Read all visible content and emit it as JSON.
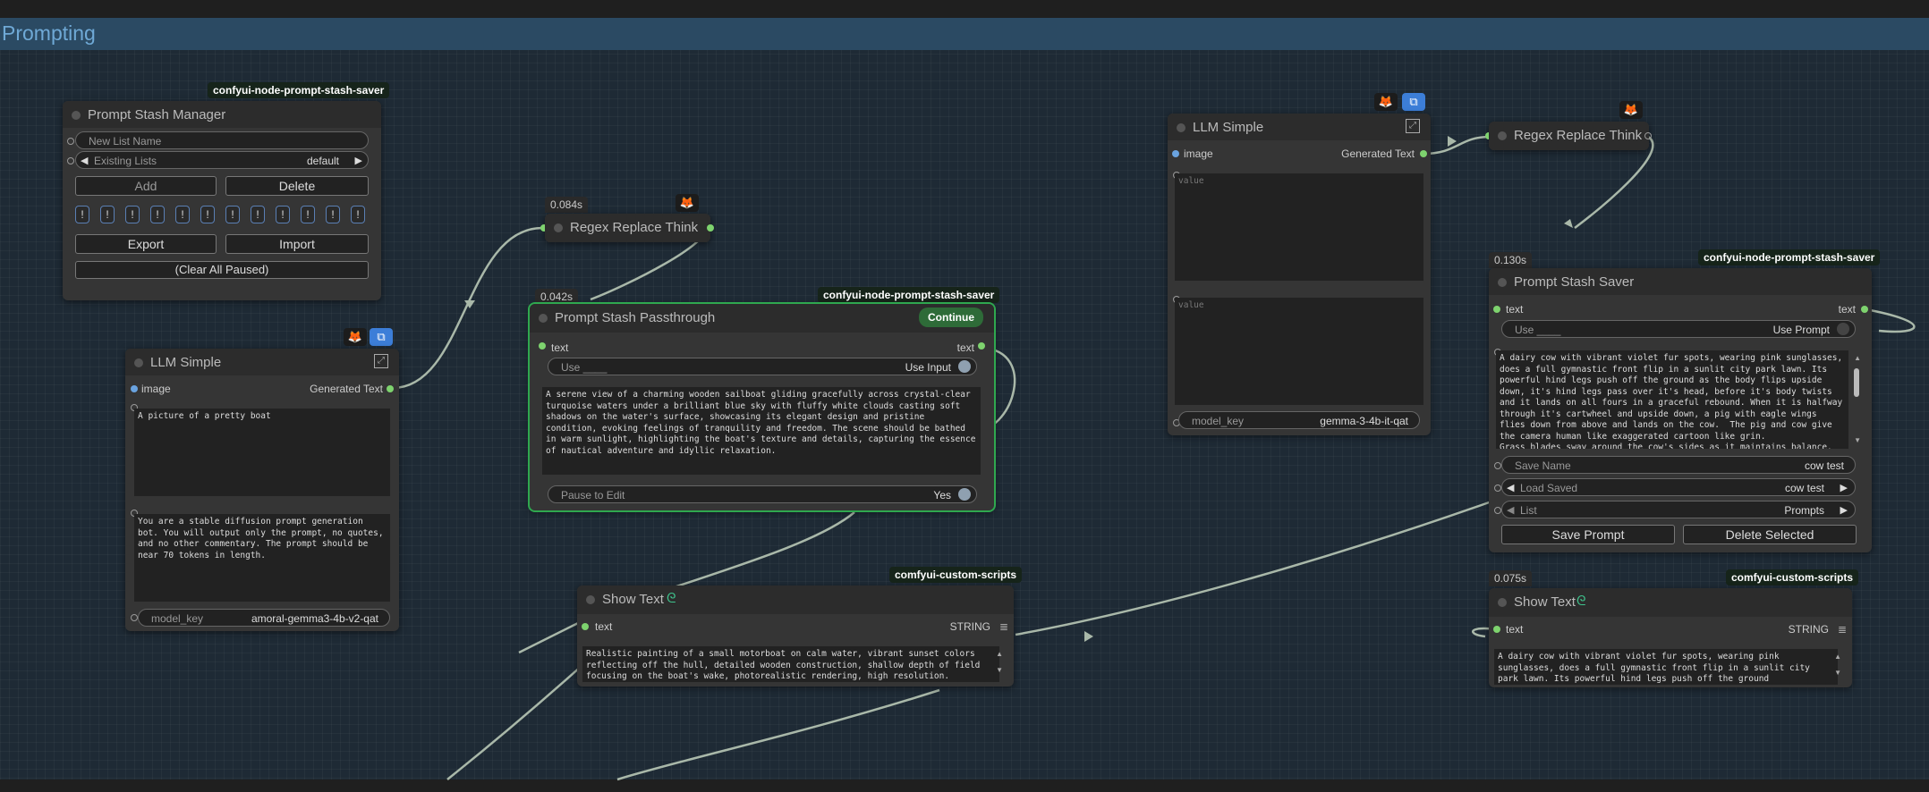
{
  "group": {
    "title": "Prompting"
  },
  "stash_manager": {
    "badge": "confyui-node-prompt-stash-saver",
    "title": "Prompt Stash Manager",
    "new_list_placeholder": "New List Name",
    "existing_lists_label": "Existing Lists",
    "existing_lists_value": "default",
    "add_label": "Add",
    "delete_label": "Delete",
    "pause_buttons": [
      "!",
      "!",
      "!",
      "!",
      "!",
      "!",
      "!",
      "!",
      "!",
      "!",
      "!",
      "!"
    ],
    "export_label": "Export",
    "import_label": "Import",
    "clear_label": "(Clear All Paused)"
  },
  "llm_left": {
    "title": "LLM Simple",
    "input_image": "image",
    "output_label": "Generated Text",
    "prompt_text": "A picture of a pretty boat",
    "system_text": "You are a stable diffusion prompt generation bot. You will output only the prompt, no quotes, and no other commentary. The prompt should be near 70 tokens in length.",
    "model_key_label": "model_key",
    "model_key_value": "amoral-gemma3-4b-v2-qat"
  },
  "regex_mid": {
    "timer": "0.084s",
    "title": "Regex Replace Think"
  },
  "passthrough": {
    "timer": "0.042s",
    "badge": "confyui-node-prompt-stash-saver",
    "title": "Prompt Stash Passthrough",
    "continue_label": "Continue",
    "input_text": "text",
    "output_text": "text",
    "use_label": "Use ____",
    "use_value": "Use Input",
    "body_text": "A serene view of a charming wooden sailboat gliding gracefully across crystal-clear turquoise waters under a brilliant blue sky with fluffy white clouds casting soft shadows on the water's surface, showcasing its elegant design and pristine condition, evoking feelings of tranquility and freedom. The scene should be bathed in warm sunlight, highlighting the boat's texture and details, capturing the essence of nautical adventure and idyllic relaxation.",
    "pause_label": "Pause to Edit",
    "pause_value": "Yes"
  },
  "show_text_mid": {
    "badge": "comfyui-custom-scripts",
    "title": "Show Text",
    "input_text": "text",
    "output_type": "STRING",
    "body_text": "Realistic painting of a small motorboat on calm water, vibrant sunset colors reflecting off the hull, detailed wooden construction, shallow depth of field focusing on the boat's wake, photorealistic rendering, high resolution."
  },
  "llm_right": {
    "title": "LLM Simple",
    "input_image": "image",
    "output_label": "Generated Text",
    "value_placeholder_1": "value",
    "value_placeholder_2": "value",
    "model_key_label": "model_key",
    "model_key_value": "gemma-3-4b-it-qat"
  },
  "regex_right": {
    "title": "Regex Replace Think"
  },
  "stash_saver": {
    "timer": "0.130s",
    "badge": "confyui-node-prompt-stash-saver",
    "title": "Prompt Stash Saver",
    "input_text": "text",
    "output_text": "text",
    "use_label": "Use ____",
    "use_value": "Use Prompt",
    "body_text": "A dairy cow with vibrant violet fur spots, wearing pink sunglasses, does a full gymnastic front flip in a sunlit city park lawn. Its powerful hind legs push off the ground as the body flips upside down, it's hind legs pass over it's head, before it's body twists and it lands on all fours in a graceful rebound. When it is halfway through it's cartwheel and upside down, a pig with eagle wings flies down from above and lands on the cow.  The pig and cow give the camera human like exaggerated cartoon like grin.\nGrass blades sway around the cow's sides as it maintains balance.",
    "save_name_label": "Save Name",
    "save_name_value": "cow test",
    "load_saved_label": "Load Saved",
    "load_saved_value": "cow test",
    "list_label": "List",
    "list_value": "Prompts",
    "save_prompt_label": "Save Prompt",
    "delete_selected_label": "Delete Selected"
  },
  "show_text_right": {
    "timer": "0.075s",
    "badge": "comfyui-custom-scripts",
    "title": "Show Text",
    "input_text": "text",
    "output_type": "STRING",
    "body_text": "A dairy cow with vibrant violet fur spots, wearing pink sunglasses, does a full gymnastic front flip in a sunlit city park lawn. Its powerful hind legs push off the ground"
  },
  "colors": {
    "wire": "#a9b8a9",
    "slot_green": "#7ed36e",
    "slot_blue": "#6aa3e0",
    "continue": "#2e6b38",
    "group": "#2b4a63"
  }
}
